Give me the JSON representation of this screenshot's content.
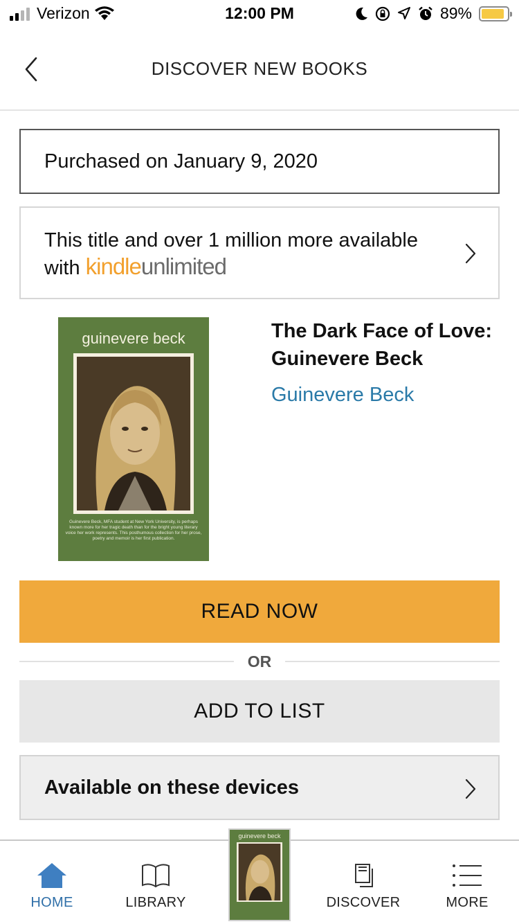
{
  "status_bar": {
    "carrier": "Verizon",
    "time": "12:00 PM",
    "battery_percent": "89%"
  },
  "nav": {
    "title": "DISCOVER NEW BOOKS"
  },
  "purchase": {
    "text": "Purchased on January 9, 2020"
  },
  "kindle_unlimited": {
    "line1": "This title and over 1 million more available",
    "with": "with",
    "logo_kindle": "kindle",
    "logo_unlimited": "unlimited"
  },
  "book": {
    "title": "The Dark Face of Love: Guinevere Beck",
    "author": "Guinevere Beck",
    "cover_author": "guinevere beck",
    "cover_blurb": "Guinevere Beck, MFA student at New York University, is perhaps known more for her tragic death than for the bright young literary voice her work represents. This posthumous collection for her prose, poetry and memoir is her first publication."
  },
  "actions": {
    "read_now": "READ NOW",
    "or": "OR",
    "add_to_list": "ADD TO LIST",
    "devices": "Available on these devices"
  },
  "tabs": [
    {
      "label": "HOME",
      "icon": "home-icon",
      "active": true
    },
    {
      "label": "LIBRARY",
      "icon": "book-icon",
      "active": false
    },
    {
      "label": "DISCOVER",
      "icon": "discover-icon",
      "active": false
    },
    {
      "label": "MORE",
      "icon": "menu-icon",
      "active": false
    }
  ],
  "colors": {
    "accent_orange": "#f0a93c",
    "link_blue": "#2a7aa8",
    "active_tab": "#2f6fa8",
    "cover_green": "#5d7d3f"
  }
}
